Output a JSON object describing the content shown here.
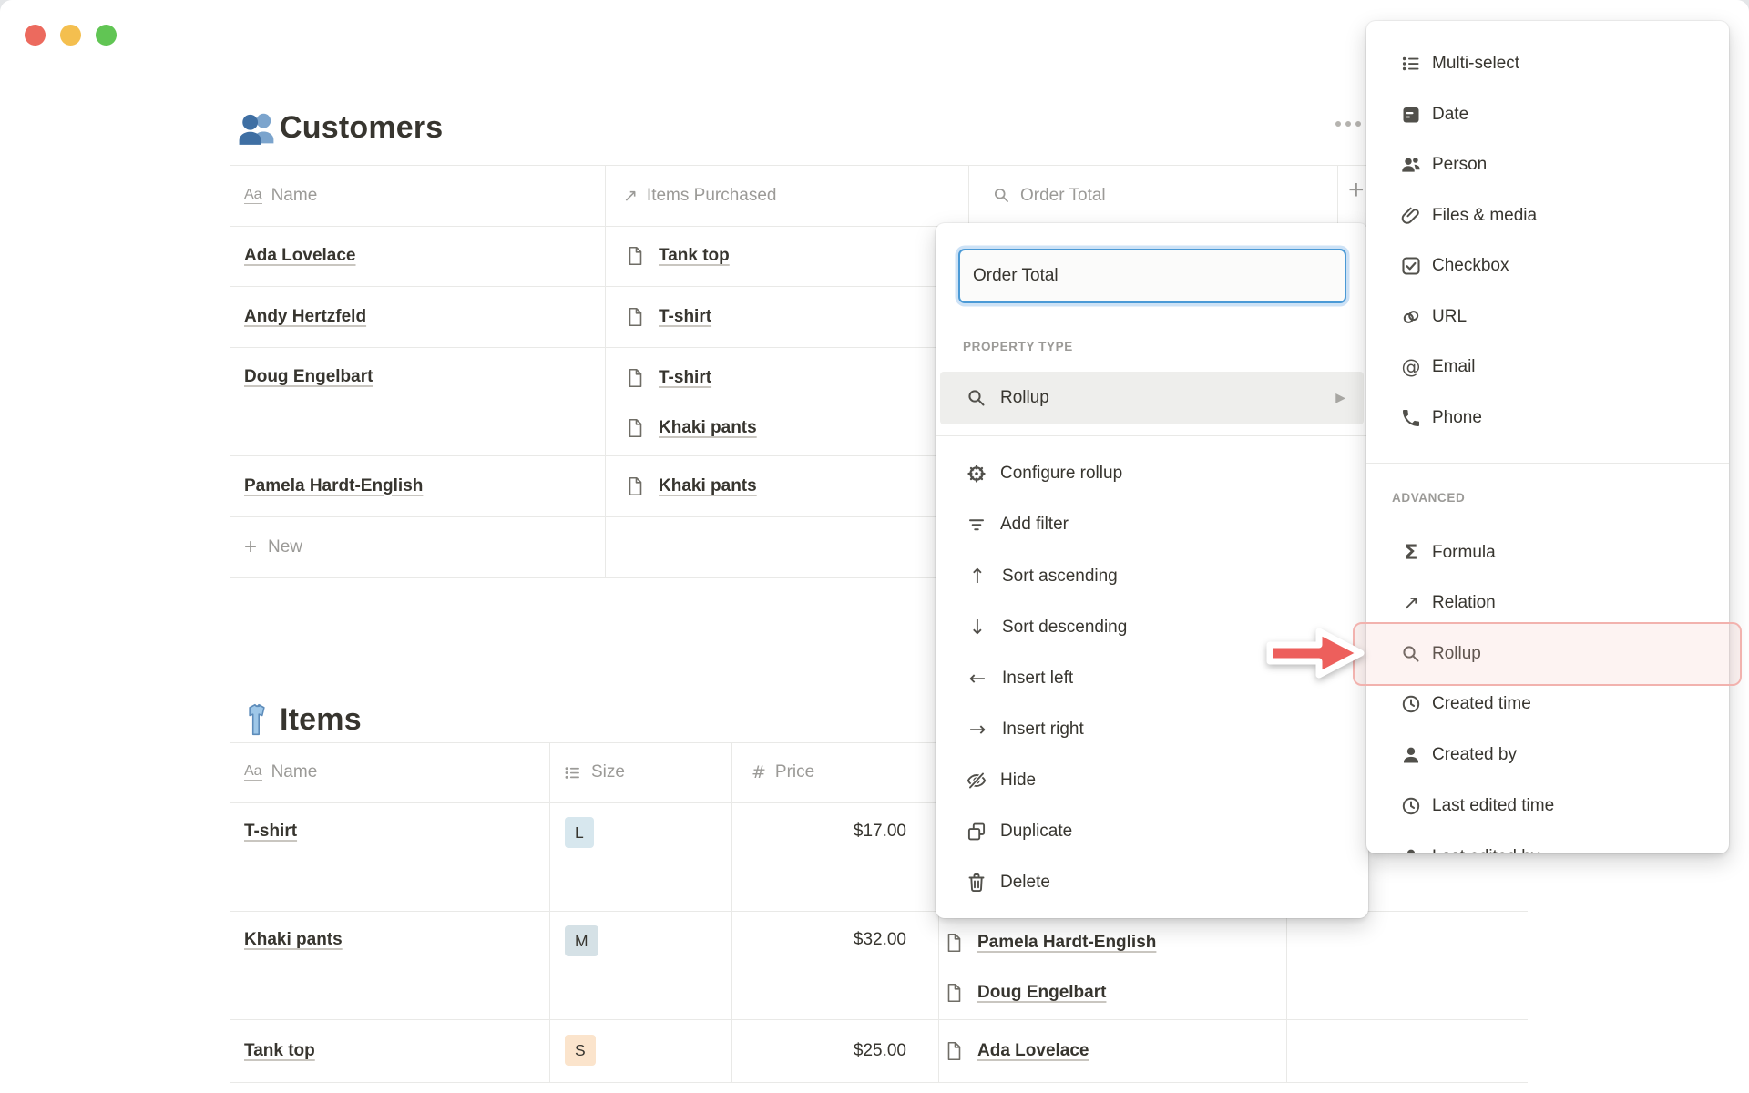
{
  "colors": {
    "traffic_red": "#ec6a5e",
    "traffic_yellow": "#f4bf4f",
    "traffic_green": "#61c554",
    "focus_blue_border": "#4b9ad6",
    "focus_blue_halo": "#cde2f6",
    "selected_row_bg": "#eeeeec",
    "table_line": "#e9e9e7",
    "chip_blue": "#d7e7ee",
    "chip_grayblue": "#d5e1e6",
    "chip_peach": "#fbe4cc",
    "annotation_red": "#ed5f5c",
    "annotation_pink_border": "#f2b2ae",
    "text_dark": "#37352f",
    "text_gray": "#9b9a97"
  },
  "customers_section": {
    "title": "Customers",
    "columns": [
      {
        "label": "Name"
      },
      {
        "label": "Items Purchased"
      },
      {
        "label": "Order Total"
      }
    ],
    "rows": [
      {
        "name": "Ada Lovelace",
        "items": [
          "Tank top"
        ]
      },
      {
        "name": "Andy Hertzfeld",
        "items": [
          "T-shirt"
        ]
      },
      {
        "name": "Doug Engelbart",
        "items": [
          "T-shirt",
          "Khaki pants"
        ]
      },
      {
        "name": "Pamela Hardt-English",
        "items": [
          "Khaki pants"
        ]
      }
    ],
    "new_label": "New"
  },
  "items_section": {
    "title": "Items",
    "columns": [
      {
        "label": "Name"
      },
      {
        "label": "Size"
      },
      {
        "label": "Price"
      }
    ],
    "rows": [
      {
        "name": "T-shirt",
        "size": "L",
        "price": "$17.00",
        "customers": []
      },
      {
        "name": "Khaki pants",
        "size": "M",
        "price": "$32.00",
        "customers": [
          "Pamela Hardt-English",
          "Doug Engelbart"
        ]
      },
      {
        "name": "Tank top",
        "size": "S",
        "price": "$25.00",
        "customers": [
          "Ada Lovelace"
        ]
      }
    ]
  },
  "property_menu": {
    "name_input_value": "Order Total",
    "section_label": "PROPERTY TYPE",
    "selected_type": "Rollup",
    "actions": [
      "Configure rollup",
      "Add filter",
      "Sort ascending",
      "Sort descending",
      "Insert left",
      "Insert right",
      "Hide",
      "Duplicate",
      "Delete"
    ]
  },
  "type_menu": {
    "basic_items": [
      "Multi-select",
      "Date",
      "Person",
      "Files & media",
      "Checkbox",
      "URL",
      "Email",
      "Phone"
    ],
    "advanced_label": "ADVANCED",
    "advanced_items": [
      "Formula",
      "Relation",
      "Rollup",
      "Created time",
      "Created by",
      "Last edited time",
      "Last edited by"
    ]
  }
}
